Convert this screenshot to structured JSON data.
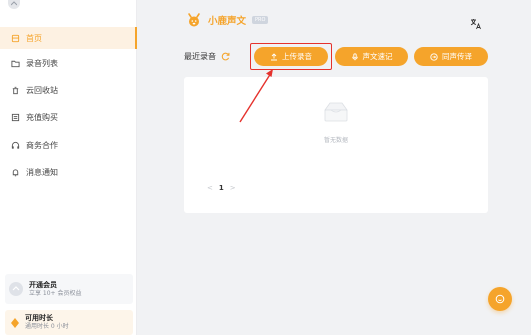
{
  "brand": {
    "name": "小鹿声文",
    "badge": "PRO"
  },
  "sidebar": {
    "items": [
      {
        "label": "首页",
        "icon": "home-icon",
        "active": true
      },
      {
        "label": "录音列表",
        "icon": "folder-icon",
        "active": false
      },
      {
        "label": "云回收站",
        "icon": "trash-icon",
        "active": false
      },
      {
        "label": "充值购买",
        "icon": "purchase-icon",
        "active": false
      },
      {
        "label": "商务合作",
        "icon": "headset-icon",
        "active": false
      },
      {
        "label": "消息通知",
        "icon": "bell-icon",
        "active": false
      }
    ],
    "member": {
      "title": "开通会员",
      "subtitle": "立享 10+ 会员权益"
    },
    "time": {
      "title": "可用时长",
      "subtitle": "通用时长 0 小时"
    }
  },
  "main": {
    "section_title": "最近录音",
    "buttons": {
      "upload": "上传录音",
      "voice_note": "声文速记",
      "interpret": "同声传译"
    },
    "empty_text": "暂无数据",
    "pager": {
      "prev": "<",
      "page": "1",
      "next": ">"
    }
  },
  "colors": {
    "accent": "#f5a42b",
    "highlight": "#e5322d",
    "active_bg": "#fdf1e2"
  }
}
